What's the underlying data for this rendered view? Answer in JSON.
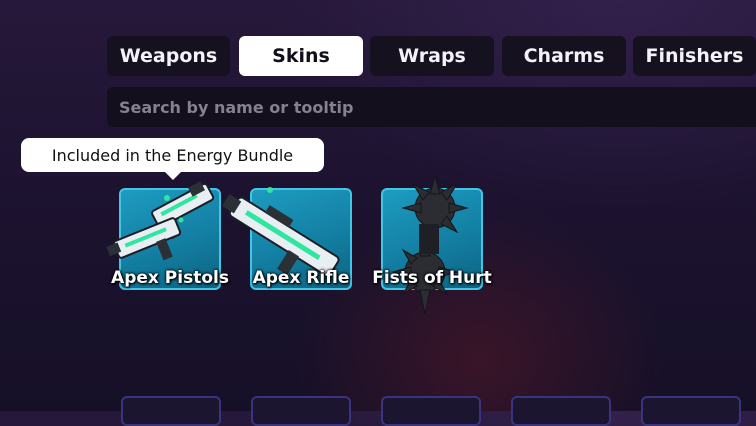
{
  "tabs": [
    {
      "label": "Weapons",
      "active": false
    },
    {
      "label": "Skins",
      "active": true
    },
    {
      "label": "Wraps",
      "active": false
    },
    {
      "label": "Charms",
      "active": false
    },
    {
      "label": "Finishers",
      "active": false
    }
  ],
  "search": {
    "placeholder": "Search by name or tooltip",
    "value": ""
  },
  "tooltip": {
    "text": "Included in the Energy Bundle"
  },
  "items": [
    {
      "name": "Apex Pistols",
      "icon": "apex-pistols-icon"
    },
    {
      "name": "Apex Rifle",
      "icon": "apex-rifle-icon"
    },
    {
      "name": "Fists of Hurt",
      "icon": "spiked-fists-icon"
    }
  ],
  "colors": {
    "card_border": "#42c5e6",
    "card_fill": "#1584a8",
    "tab_active_bg": "#ffffff",
    "tab_bg": "#15111e",
    "accent_green": "#2fe6a0"
  }
}
